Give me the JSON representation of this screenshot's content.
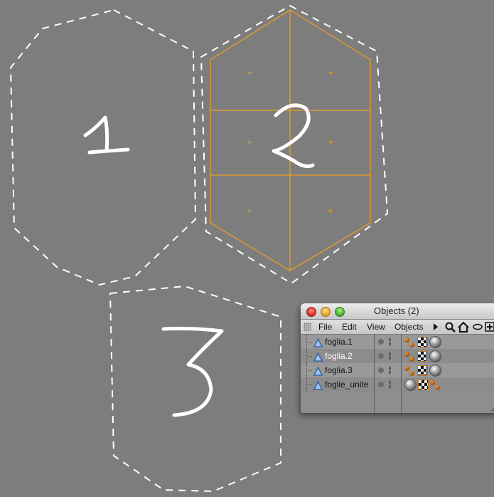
{
  "viewport": {
    "background": "#7d7d7d",
    "handwritten_numbers": [
      "1",
      "2",
      "3"
    ],
    "selection_color": "#f0a020"
  },
  "objects_window": {
    "title": "Objects (2)",
    "menu": {
      "file": "File",
      "edit": "Edit",
      "view": "View",
      "objects": "Objects"
    },
    "toolbar_icons": [
      "play-arrow-icon",
      "search-icon",
      "home-icon",
      "eye-icon",
      "add-icon"
    ],
    "objects": [
      {
        "name": "foglia.1",
        "selected": false,
        "tags": [
          "phong-tag-icon",
          "texture-tag-icon",
          "material-sphere-icon"
        ]
      },
      {
        "name": "foglia.2",
        "selected": true,
        "tags": [
          "phong-tag-icon",
          "texture-tag-icon",
          "material-sphere-icon"
        ]
      },
      {
        "name": "foglia.3",
        "selected": false,
        "tags": [
          "phong-tag-icon",
          "texture-tag-icon",
          "material-sphere-icon"
        ]
      },
      {
        "name": "foglie_unite",
        "selected": false,
        "tags": [
          "material-sphere-icon",
          "texture-tag-icon",
          "phong-tag-icon"
        ]
      }
    ]
  }
}
